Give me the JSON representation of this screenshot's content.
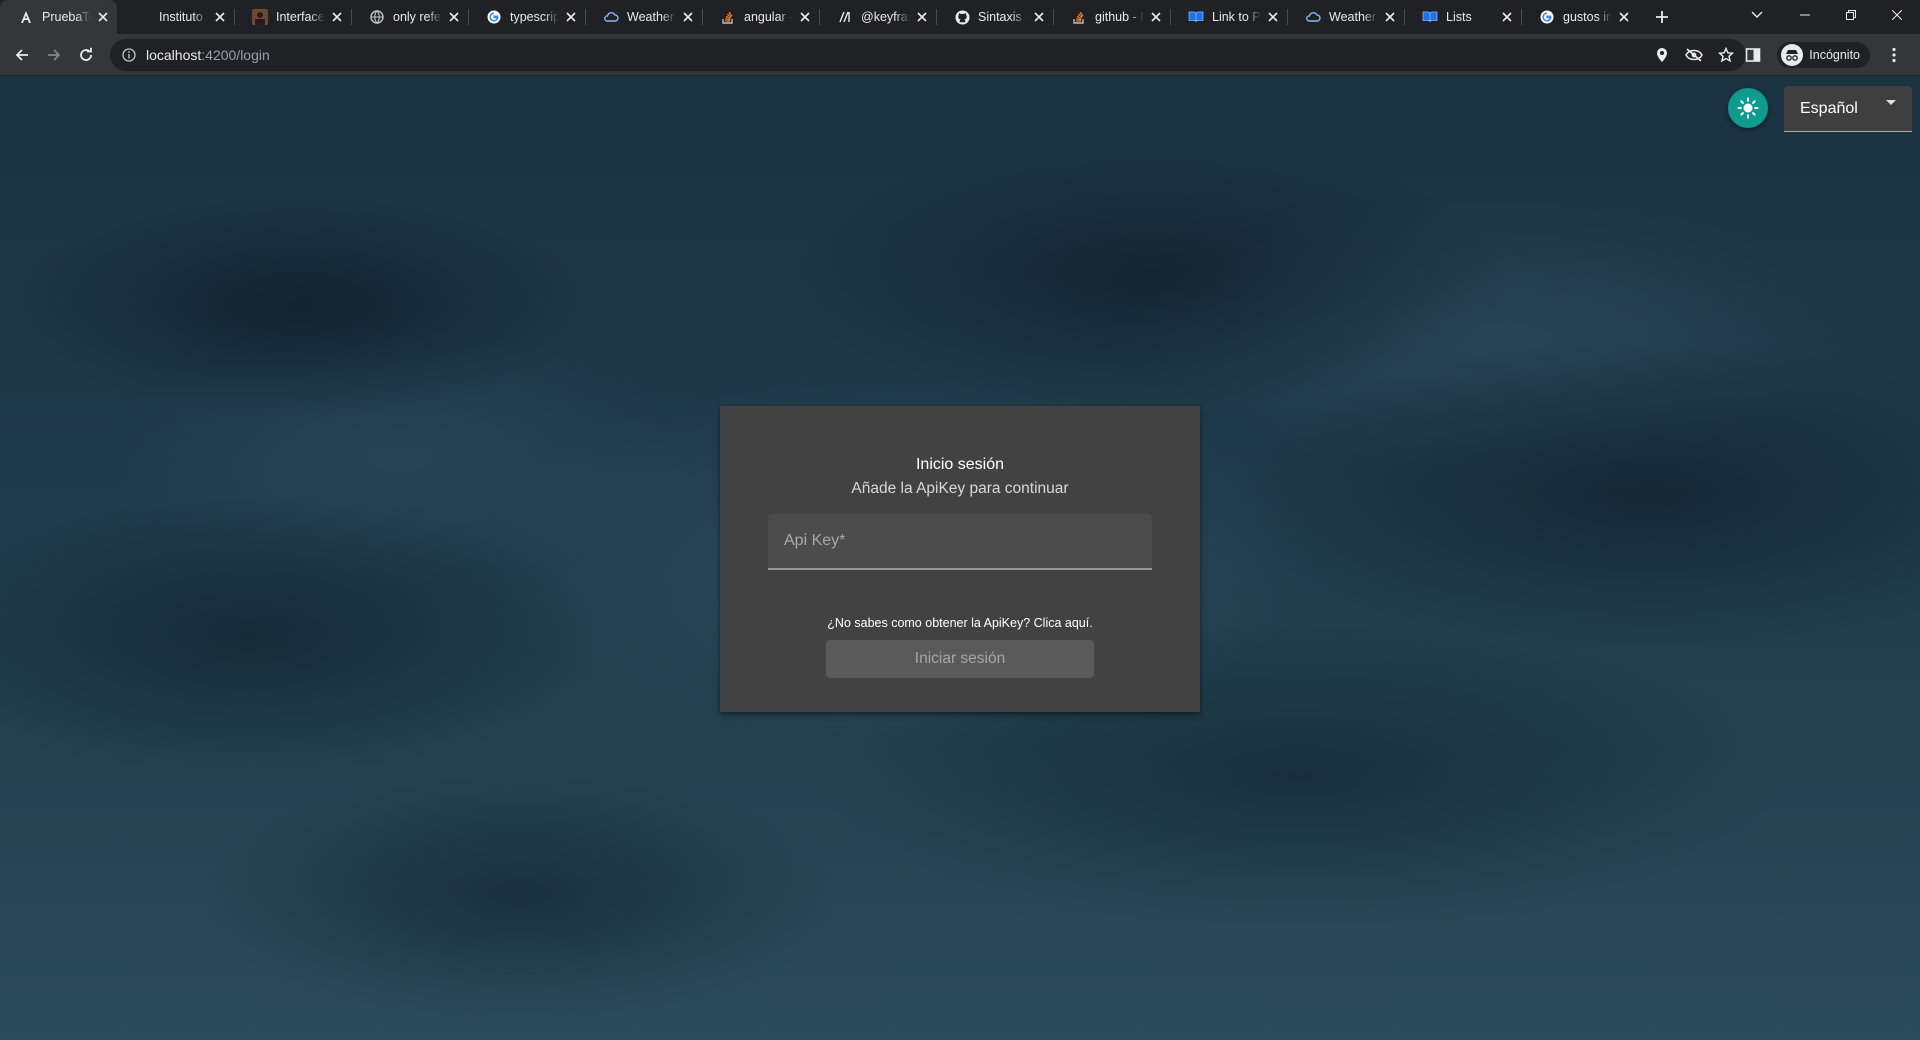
{
  "browser": {
    "tabs": [
      {
        "title": "PruebaTec",
        "favicon": "angular-a-icon"
      },
      {
        "title": "Instituto T",
        "favicon": "blank-icon"
      },
      {
        "title": "Interfaces",
        "favicon": "avatar-icon"
      },
      {
        "title": "only refere",
        "favicon": "globe-icon"
      },
      {
        "title": "typescript",
        "favicon": "google-icon"
      },
      {
        "title": "Weather D",
        "favicon": "weather-icon"
      },
      {
        "title": "angular - ",
        "favicon": "stackoverflow-icon"
      },
      {
        "title": "@keyfram",
        "favicon": "mdn-icon"
      },
      {
        "title": "Sintaxis de",
        "favicon": "github-icon"
      },
      {
        "title": "github - N",
        "favicon": "stackoverflow-icon"
      },
      {
        "title": "Link to Pa",
        "favicon": "book-icon"
      },
      {
        "title": "Weather D",
        "favicon": "weather-icon"
      },
      {
        "title": "Lists",
        "favicon": "book-icon"
      },
      {
        "title": "gustos ing",
        "favicon": "google-icon"
      }
    ],
    "url_host": "localhost",
    "url_path": ":4200/login",
    "profile_label": "Incógnito"
  },
  "header": {
    "language_value": "Español"
  },
  "login": {
    "title": "Inicio sesión",
    "subtitle": "Añade la ApiKey para continuar",
    "apikey_placeholder": "Api Key*",
    "help_link": "¿No sabes como obtener la ApiKey? Clica aquí.",
    "submit_label": "Iniciar sesión"
  },
  "colors": {
    "accent": "#0f9b8e",
    "card_bg": "#424242",
    "chrome_bg": "#202124"
  }
}
